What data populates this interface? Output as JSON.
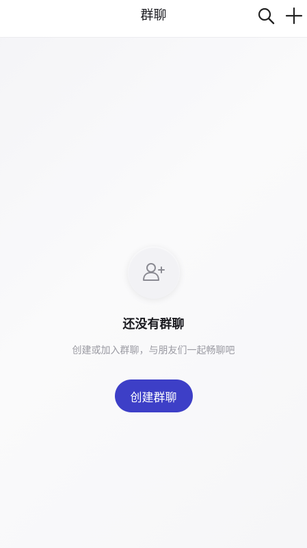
{
  "header": {
    "title": "群聊",
    "search_icon": "search-icon",
    "add_icon": "plus-icon"
  },
  "empty_state": {
    "icon": "add-user-icon",
    "title": "还没有群聊",
    "subtitle": "创建或加入群聊，与朋友们一起畅聊吧",
    "button_label": "创建群聊"
  },
  "colors": {
    "accent": "#3d3fc7",
    "background": "#f6f6f8",
    "header_bg": "#ffffff",
    "subtitle": "#9a9aa2",
    "icon_gray": "#8a8a92"
  }
}
